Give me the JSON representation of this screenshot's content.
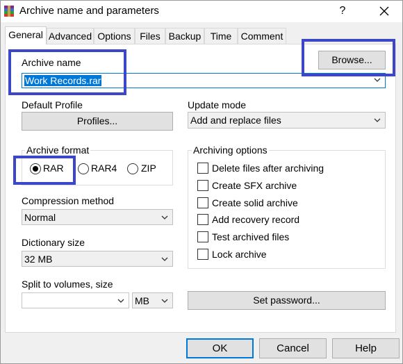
{
  "window": {
    "title": "Archive name and parameters",
    "help_glyph": "?"
  },
  "tabs": [
    {
      "label": "General",
      "active": true
    },
    {
      "label": "Advanced"
    },
    {
      "label": "Options"
    },
    {
      "label": "Files"
    },
    {
      "label": "Backup"
    },
    {
      "label": "Time"
    },
    {
      "label": "Comment"
    }
  ],
  "archive_name": {
    "label": "Archive name",
    "value": "Work Records.rar",
    "browse_label": "Browse..."
  },
  "default_profile": {
    "label": "Default Profile",
    "button_label": "Profiles..."
  },
  "update_mode": {
    "label": "Update mode",
    "value": "Add and replace files"
  },
  "archive_format": {
    "label": "Archive format",
    "options": [
      {
        "label": "RAR",
        "selected": true
      },
      {
        "label": "RAR4",
        "selected": false
      },
      {
        "label": "ZIP",
        "selected": false
      }
    ]
  },
  "compression_method": {
    "label": "Compression method",
    "value": "Normal"
  },
  "dictionary_size": {
    "label": "Dictionary size",
    "value": "32 MB"
  },
  "split_volumes": {
    "label": "Split to volumes, size",
    "value": "",
    "unit": "MB"
  },
  "archiving_options": {
    "label": "Archiving options",
    "items": [
      {
        "label": "Delete files after archiving",
        "checked": false
      },
      {
        "label": "Create SFX archive",
        "checked": false
      },
      {
        "label": "Create solid archive",
        "checked": false
      },
      {
        "label": "Add recovery record",
        "checked": false
      },
      {
        "label": "Test archived files",
        "checked": false
      },
      {
        "label": "Lock archive",
        "checked": false
      }
    ]
  },
  "set_password_label": "Set password...",
  "footer": {
    "ok_label": "OK",
    "cancel_label": "Cancel",
    "help_label": "Help"
  },
  "colors": {
    "highlight_box": "#3c46c8",
    "selection": "#0078d7"
  }
}
